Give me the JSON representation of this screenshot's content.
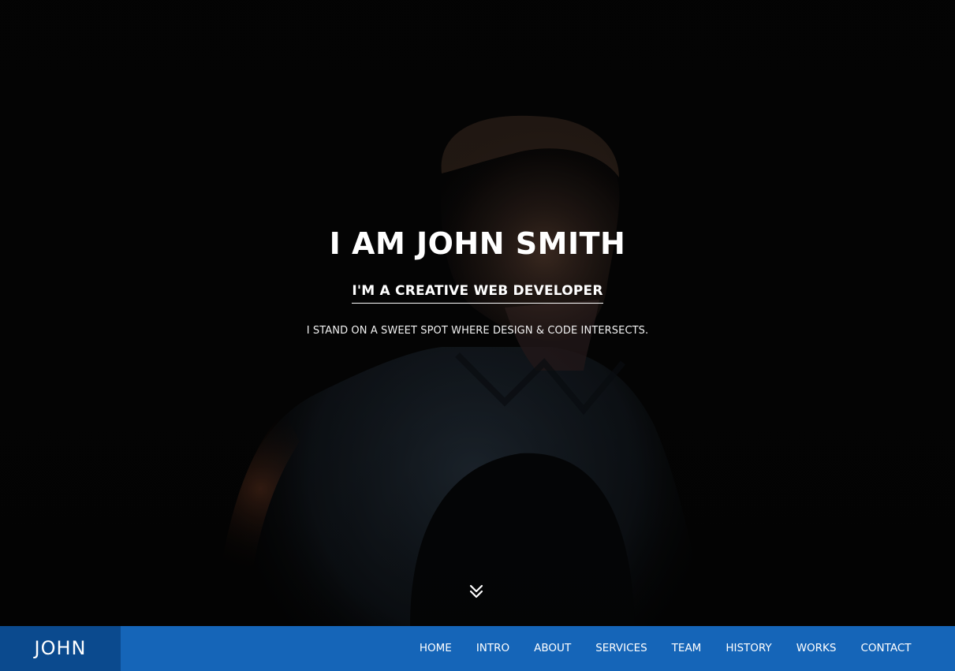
{
  "hero": {
    "title": "I AM JOHN SMITH",
    "subtitle": "I'M A CREATIVE WEB DEVELOPER",
    "tagline": "I STAND ON A SWEET SPOT WHERE DESIGN & CODE INTERSECTS.",
    "background_icon": "portrait-photo"
  },
  "scroll_icon": "double-chevron-down-icon",
  "navbar": {
    "brand": "JOHN",
    "items": [
      {
        "label": "HOME"
      },
      {
        "label": "INTRO"
      },
      {
        "label": "ABOUT"
      },
      {
        "label": "SERVICES"
      },
      {
        "label": "TEAM"
      },
      {
        "label": "HISTORY"
      },
      {
        "label": "WORKS"
      },
      {
        "label": "CONTACT"
      }
    ]
  },
  "colors": {
    "navbar_bg": "#1565b8",
    "brand_bg": "#0b4a8e",
    "hero_bg": "#050505",
    "text": "#ffffff"
  }
}
